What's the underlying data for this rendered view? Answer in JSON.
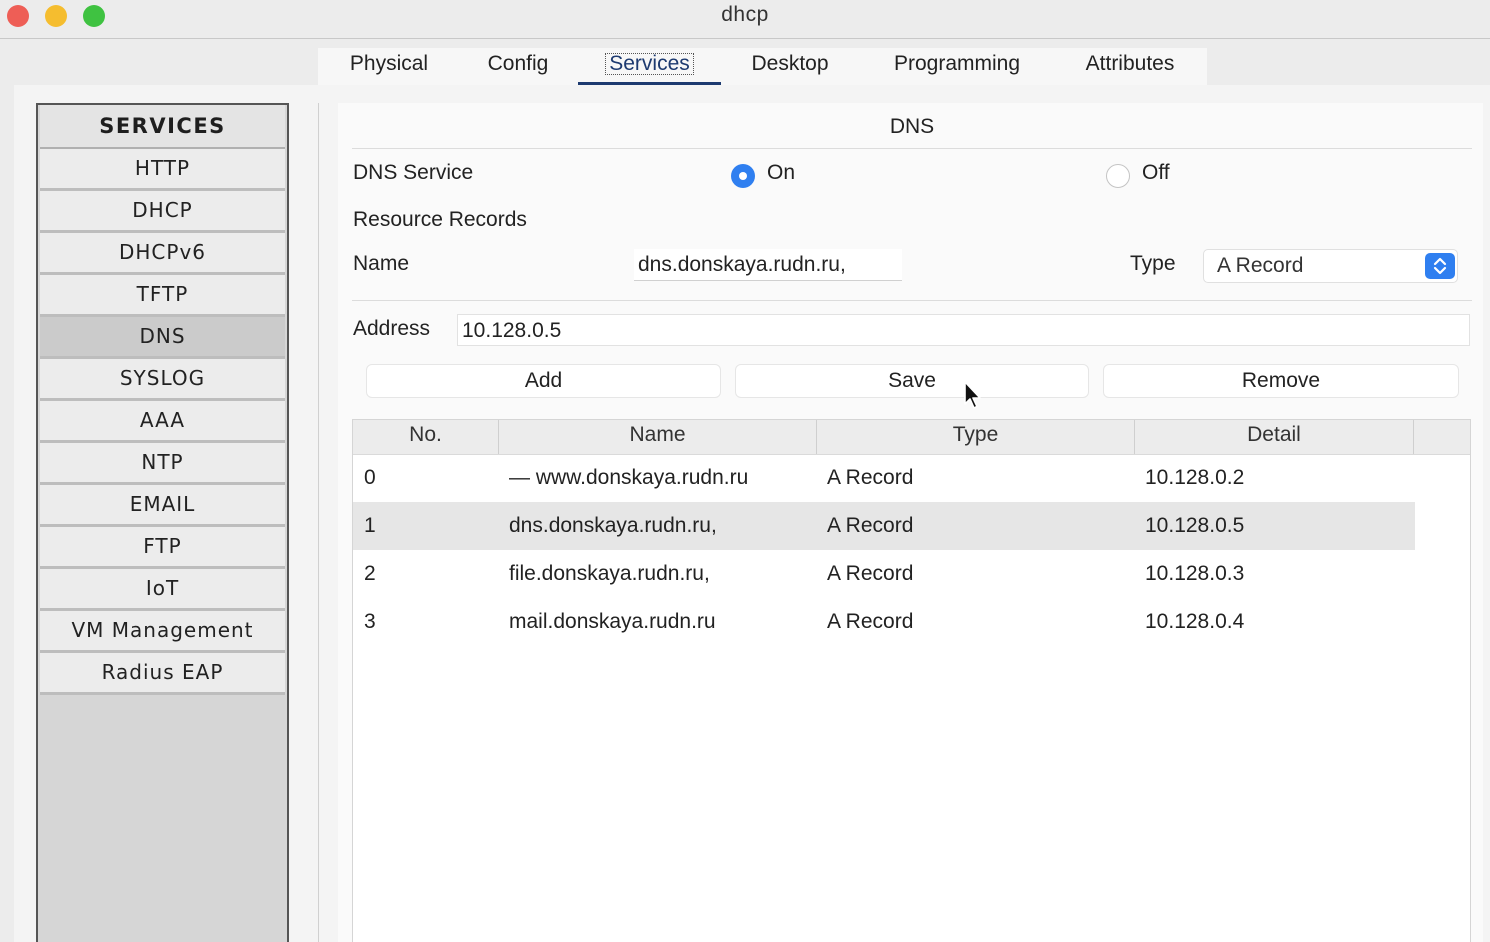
{
  "window": {
    "title": "dhcp"
  },
  "tabs": [
    {
      "label": "Physical"
    },
    {
      "label": "Config"
    },
    {
      "label": "Services",
      "active": true
    },
    {
      "label": "Desktop"
    },
    {
      "label": "Programming"
    },
    {
      "label": "Attributes"
    }
  ],
  "sidebar": {
    "header": "SERVICES",
    "items": [
      {
        "label": "HTTP"
      },
      {
        "label": "DHCP"
      },
      {
        "label": "DHCPv6"
      },
      {
        "label": "TFTP"
      },
      {
        "label": "DNS",
        "selected": true
      },
      {
        "label": "SYSLOG"
      },
      {
        "label": "AAA"
      },
      {
        "label": "NTP"
      },
      {
        "label": "EMAIL"
      },
      {
        "label": "FTP"
      },
      {
        "label": "IoT"
      },
      {
        "label": "VM Management"
      },
      {
        "label": "Radius EAP"
      }
    ]
  },
  "dns": {
    "title": "DNS",
    "service_label": "DNS Service",
    "on_label": "On",
    "off_label": "Off",
    "service_state": "On",
    "resource_records_label": "Resource Records",
    "name_label": "Name",
    "name_value": "dns.donskaya.rudn.ru,",
    "type_label": "Type",
    "type_value": "A Record",
    "address_label": "Address",
    "address_value": "10.128.0.5",
    "add_label": "Add",
    "save_label": "Save",
    "remove_label": "Remove"
  },
  "table": {
    "columns": [
      "No.",
      "Name",
      "Type",
      "Detail"
    ],
    "rows": [
      {
        "no": "0",
        "name": "— www.donskaya.rudn.ru",
        "type": "A Record",
        "detail": "10.128.0.2"
      },
      {
        "no": "1",
        "name": "dns.donskaya.rudn.ru,",
        "type": "A Record",
        "detail": "10.128.0.5",
        "selected": true
      },
      {
        "no": "2",
        "name": "file.donskaya.rudn.ru,",
        "type": "A Record",
        "detail": "10.128.0.3"
      },
      {
        "no": "3",
        "name": "mail.donskaya.rudn.ru",
        "type": "A Record",
        "detail": "10.128.0.4"
      }
    ]
  },
  "colors": {
    "accent": "#2f7ff0",
    "active_tab_underline": "#1d3a70",
    "close": "#ee5e56",
    "minimize": "#f5bd2f",
    "maximize": "#3fc241"
  }
}
